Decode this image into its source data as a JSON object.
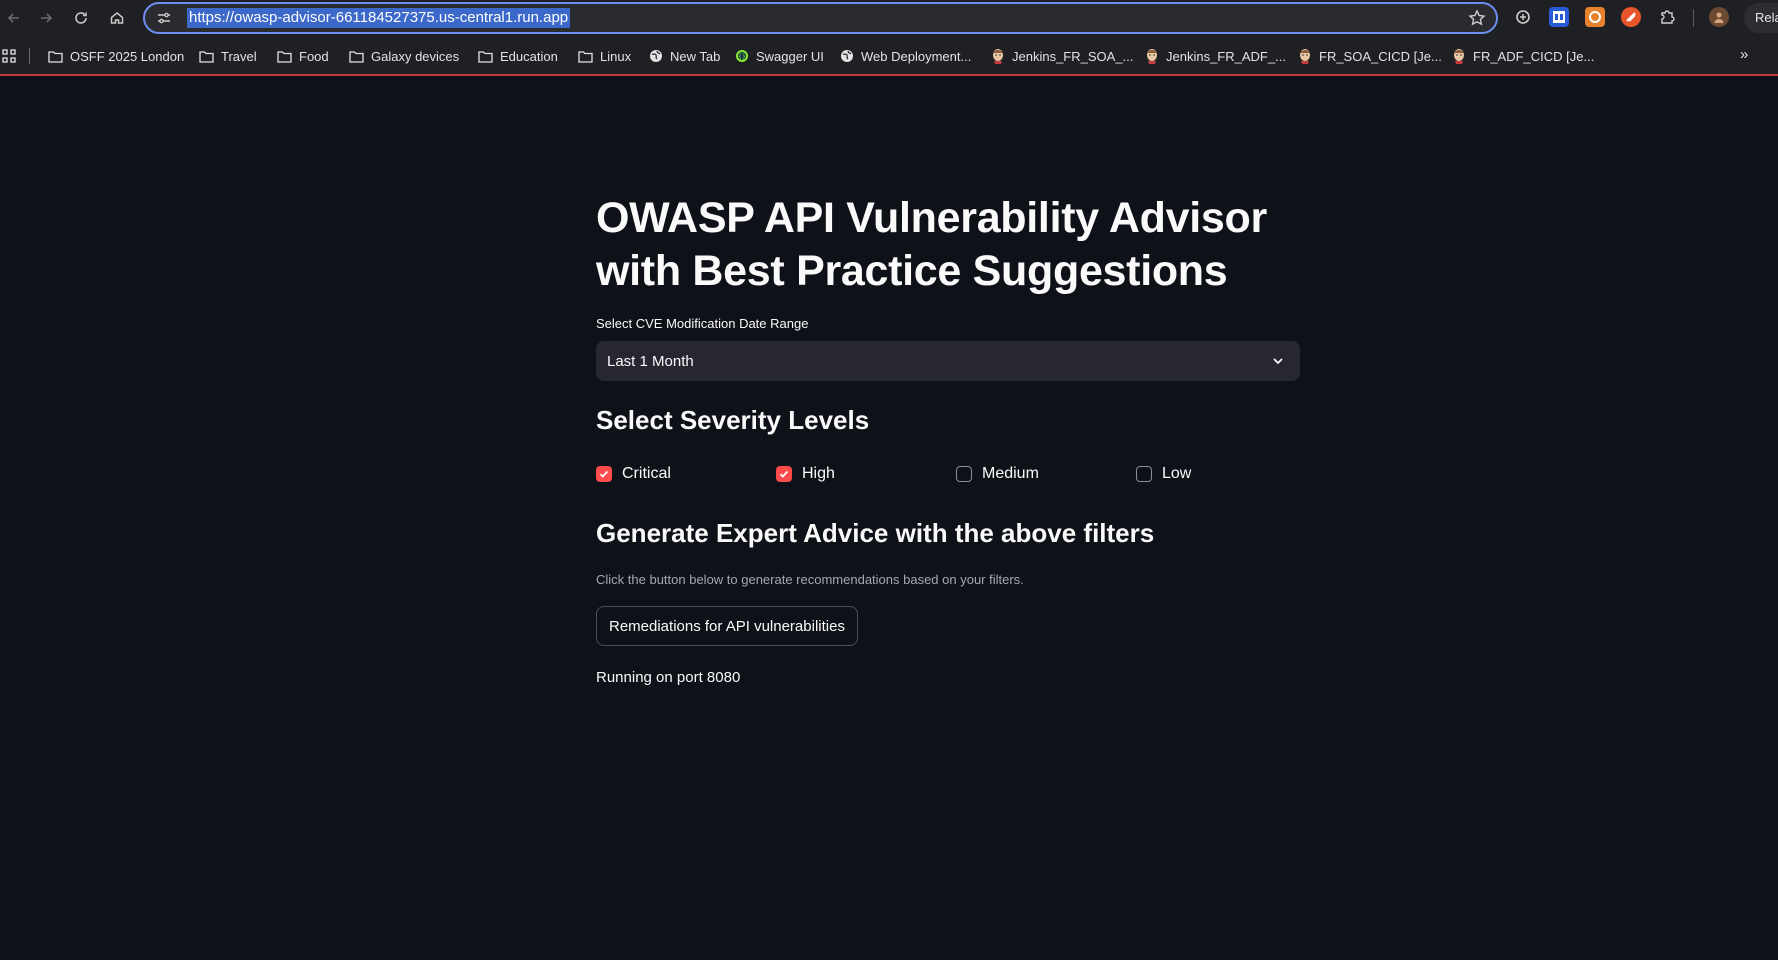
{
  "browser": {
    "url": "https://owasp-advisor-661184527375.us-central1.run.app",
    "relaunch_label": "Rela",
    "bookmarks": [
      {
        "label": "OSFF 2025 London",
        "icon": "folder-icon"
      },
      {
        "label": "Travel",
        "icon": "folder-icon"
      },
      {
        "label": "Food",
        "icon": "folder-icon"
      },
      {
        "label": "Galaxy devices",
        "icon": "folder-icon"
      },
      {
        "label": "Education",
        "icon": "folder-icon"
      },
      {
        "label": "Linux",
        "icon": "folder-icon"
      },
      {
        "label": "New Tab",
        "icon": "globe-icon"
      },
      {
        "label": "Swagger UI",
        "icon": "swagger-icon"
      },
      {
        "label": "Web Deployment...",
        "icon": "globe-icon"
      },
      {
        "label": "Jenkins_FR_SOA_...",
        "icon": "jenkins-icon"
      },
      {
        "label": "Jenkins_FR_ADF_...",
        "icon": "jenkins-icon"
      },
      {
        "label": "FR_SOA_CICD [Je...",
        "icon": "jenkins-icon"
      },
      {
        "label": "FR_ADF_CICD [Je...",
        "icon": "jenkins-icon"
      }
    ]
  },
  "app": {
    "title": "OWASP API Vulnerability Advisor with Best Practice Suggestions",
    "date_range_label": "Select CVE Modification Date Range",
    "date_range_value": "Last 1 Month",
    "severity_heading": "Select Severity Levels",
    "severities": [
      {
        "label": "Critical",
        "checked": true
      },
      {
        "label": "High",
        "checked": true
      },
      {
        "label": "Medium",
        "checked": false
      },
      {
        "label": "Low",
        "checked": false
      }
    ],
    "advice_heading": "Generate Expert Advice with the above filters",
    "advice_caption": "Click the button below to generate recommendations based on your filters.",
    "button_label": "Remediations for API vulnerabilities",
    "status_text": "Running on port 8080"
  },
  "colors": {
    "background": "#0e1117",
    "accent": "#ff4b4b",
    "select_bg": "#262730"
  }
}
